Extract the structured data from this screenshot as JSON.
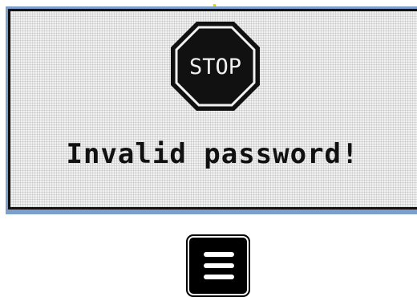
{
  "dialog": {
    "icon": "stop-sign-icon",
    "icon_text": "STOP",
    "message": "Invalid password!"
  },
  "menu": {
    "icon": "hamburger-menu-icon"
  },
  "colors": {
    "frame": "#7c9fcb",
    "lcd_background": "#f1f1f1",
    "ink": "#111111",
    "marker": "#e8d200"
  }
}
